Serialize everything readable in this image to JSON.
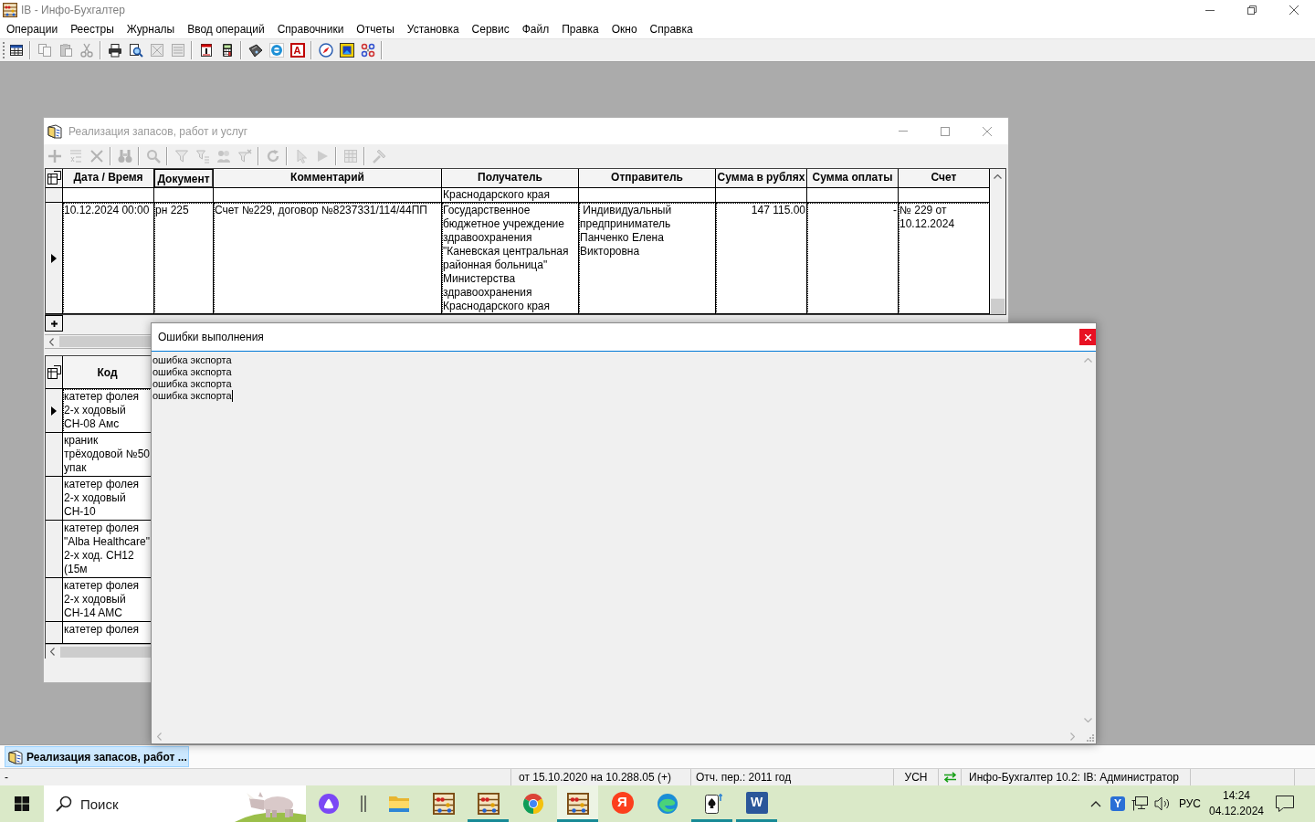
{
  "app_window": {
    "title": "IB - Инфо-Бухгалтер"
  },
  "menu_bar": [
    "Операции",
    "Реестры",
    "Журналы",
    "Ввод операций",
    "Справочники",
    "Отчеты",
    "Установка",
    "Сервис",
    "Файл",
    "Правка",
    "Окно",
    "Справка"
  ],
  "main_toolbar": {
    "groups": [
      [
        {
          "disabled": false
        }
      ],
      [
        {
          "disabled": true
        },
        {
          "disabled": true
        },
        {
          "disabled": true
        }
      ],
      [
        {
          "disabled": false
        },
        {
          "disabled": false
        },
        {
          "disabled": true
        },
        {
          "disabled": true
        }
      ],
      [
        {
          "disabled": false
        },
        {
          "disabled": false
        }
      ],
      [
        {
          "disabled": false
        },
        {
          "disabled": false
        },
        {
          "disabled": false,
          "glyph": "A"
        }
      ],
      [
        {
          "disabled": false
        },
        {
          "disabled": false
        },
        {
          "disabled": false
        }
      ]
    ]
  },
  "document_window": {
    "title": "Реализация запасов, работ и услуг",
    "toolbar": {
      "groups": [
        [
          {
            "disabled": true
          },
          {
            "disabled": true
          },
          {
            "disabled": true
          }
        ],
        [
          {
            "disabled": true
          }
        ],
        [
          {
            "disabled": true
          }
        ],
        [
          {
            "disabled": true
          },
          {
            "disabled": true
          },
          {
            "disabled": true
          },
          {
            "disabled": true
          }
        ],
        [
          {
            "disabled": true
          }
        ],
        [
          {
            "disabled": true
          },
          {
            "disabled": true
          }
        ],
        [
          {
            "disabled": true
          }
        ],
        [
          {
            "disabled": true
          }
        ]
      ]
    },
    "documents_table": {
      "columns": [
        {
          "label": "Дата / Время",
          "sorted": false
        },
        {
          "label": "Документ",
          "sorted": true
        },
        {
          "label": "Комментарий",
          "sorted": false
        },
        {
          "label": "Получатель",
          "sorted": false
        },
        {
          "label": "Отправитель",
          "sorted": false
        },
        {
          "label": "Сумма в рублях",
          "sorted": false
        },
        {
          "label": "Сумма оплаты",
          "sorted": false
        },
        {
          "label": "Счет",
          "sorted": false
        }
      ],
      "rows": [
        {
          "selected": false,
          "cells": {
            "recipient": "Краснодарского края"
          }
        },
        {
          "selected": true,
          "cells": {
            "date_time": "10.12.2024 00:00",
            "document": "рн 225",
            "comment": "Счет №229, договор №8237331/114/44ПП",
            "recipient": "Государственное бюджетное учреждение здравоохранения \"Каневская центральная районная больница\" Министерства здравоохранения Краснодарского края",
            "sender": " Индивидуальный предприниматель Панченко Елена Викторовна",
            "amount_rub": "147 115.00",
            "amount_paid": "-",
            "invoice": "№ 229 от 10.12.2024"
          }
        }
      ]
    },
    "items_table": {
      "columns": [
        {
          "label": "Код"
        }
      ],
      "rows": [
        {
          "selected": true,
          "code": "катетер фолея 2-х ходовый CH-08 Амс"
        },
        {
          "selected": false,
          "code": "краник трёходовой №50 упак"
        },
        {
          "selected": false,
          "code": "катетер фолея 2-х ходовый CH-10"
        },
        {
          "selected": false,
          "code": "катетер фолея \"Alba Healthcare\" 2-х ход. CH12 (15м"
        },
        {
          "selected": false,
          "code": "катетер фолея 2-х ходовый CH-14 AMC"
        },
        {
          "selected": false,
          "code": "катетер фолея"
        }
      ]
    }
  },
  "error_dialog": {
    "title": "Ошибки выполнения",
    "lines": [
      {
        "text": "ошибка экспорта",
        "cursor": false
      },
      {
        "text": "ошибка экспорта",
        "cursor": false
      },
      {
        "text": "ошибка экспорта",
        "cursor": false
      },
      {
        "text": "ошибка экспорта",
        "cursor": true
      }
    ]
  },
  "window_tabs": [
    {
      "label": "Реализация запасов, работ ...",
      "selected": true
    }
  ],
  "status_bar": [
    "-",
    "от 15.10.2020 на 10.288.05 (+)",
    "Отч. пер.: 2011 год",
    "УСН",
    "Инфо-Бухгалтер 10.2: IB: Администратор"
  ],
  "taskbar": {
    "search": {
      "placeholder": "Поиск"
    },
    "apps": [
      {
        "running": false,
        "active": false
      },
      {
        "running": false,
        "active": false
      },
      {
        "running": false,
        "active": false
      },
      {
        "running": false,
        "active": false
      },
      {
        "running": true,
        "active": false
      },
      {
        "running": false,
        "active": false
      },
      {
        "running": true,
        "active": true
      },
      {
        "running": false,
        "active": false,
        "glyph": "Я"
      },
      {
        "running": false,
        "active": false
      },
      {
        "running": true,
        "active": false
      },
      {
        "running": true,
        "active": false,
        "glyph": "W"
      }
    ],
    "tray": {
      "app_glyph": "Y",
      "language": "РУС",
      "time": "14:24",
      "date": "04.12.2024"
    }
  }
}
